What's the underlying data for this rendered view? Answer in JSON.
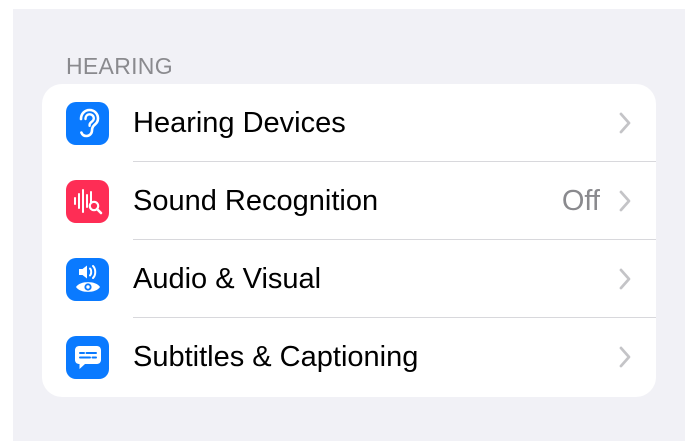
{
  "section": {
    "header": "HEARING"
  },
  "rows": [
    {
      "label": "Hearing Devices",
      "value": "",
      "icon": "ear-icon",
      "icon_color": "#0a7aff"
    },
    {
      "label": "Sound Recognition",
      "value": "Off",
      "icon": "sound-recognition-icon",
      "icon_color": "#fe2d55"
    },
    {
      "label": "Audio & Visual",
      "value": "",
      "icon": "audio-visual-icon",
      "icon_color": "#0a7aff"
    },
    {
      "label": "Subtitles & Captioning",
      "value": "",
      "icon": "captions-icon",
      "icon_color": "#0a7aff"
    }
  ],
  "colors": {
    "background": "#f1f1f6",
    "secondary_text": "#8a8a8e",
    "chevron": "#c4c4c7"
  }
}
